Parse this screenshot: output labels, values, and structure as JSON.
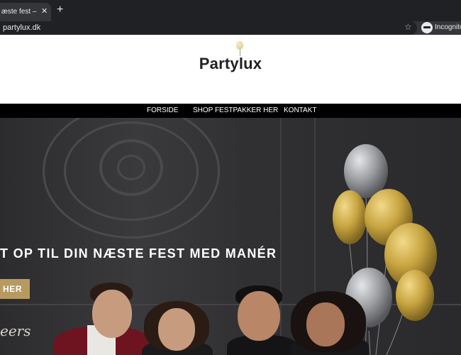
{
  "browser": {
    "tab_title": "æste fest – Par",
    "tab_close": "✕",
    "new_tab": "+",
    "url": "partylux.dk",
    "star_icon": "☆",
    "incognito_label": "Incognito"
  },
  "site": {
    "logo_text": "Partylux"
  },
  "nav": {
    "items": [
      "FORSIDE",
      "SHOP FESTPAKKER HER",
      "KONTAKT"
    ]
  },
  "hero": {
    "headline": "T OP TIL DIN NÆSTE FEST MED MANÉR",
    "cta_label": "HER",
    "decor_text": "eers",
    "colors": {
      "gold": "#b69a60",
      "silver": "#8e9094",
      "background": "#303032"
    }
  }
}
